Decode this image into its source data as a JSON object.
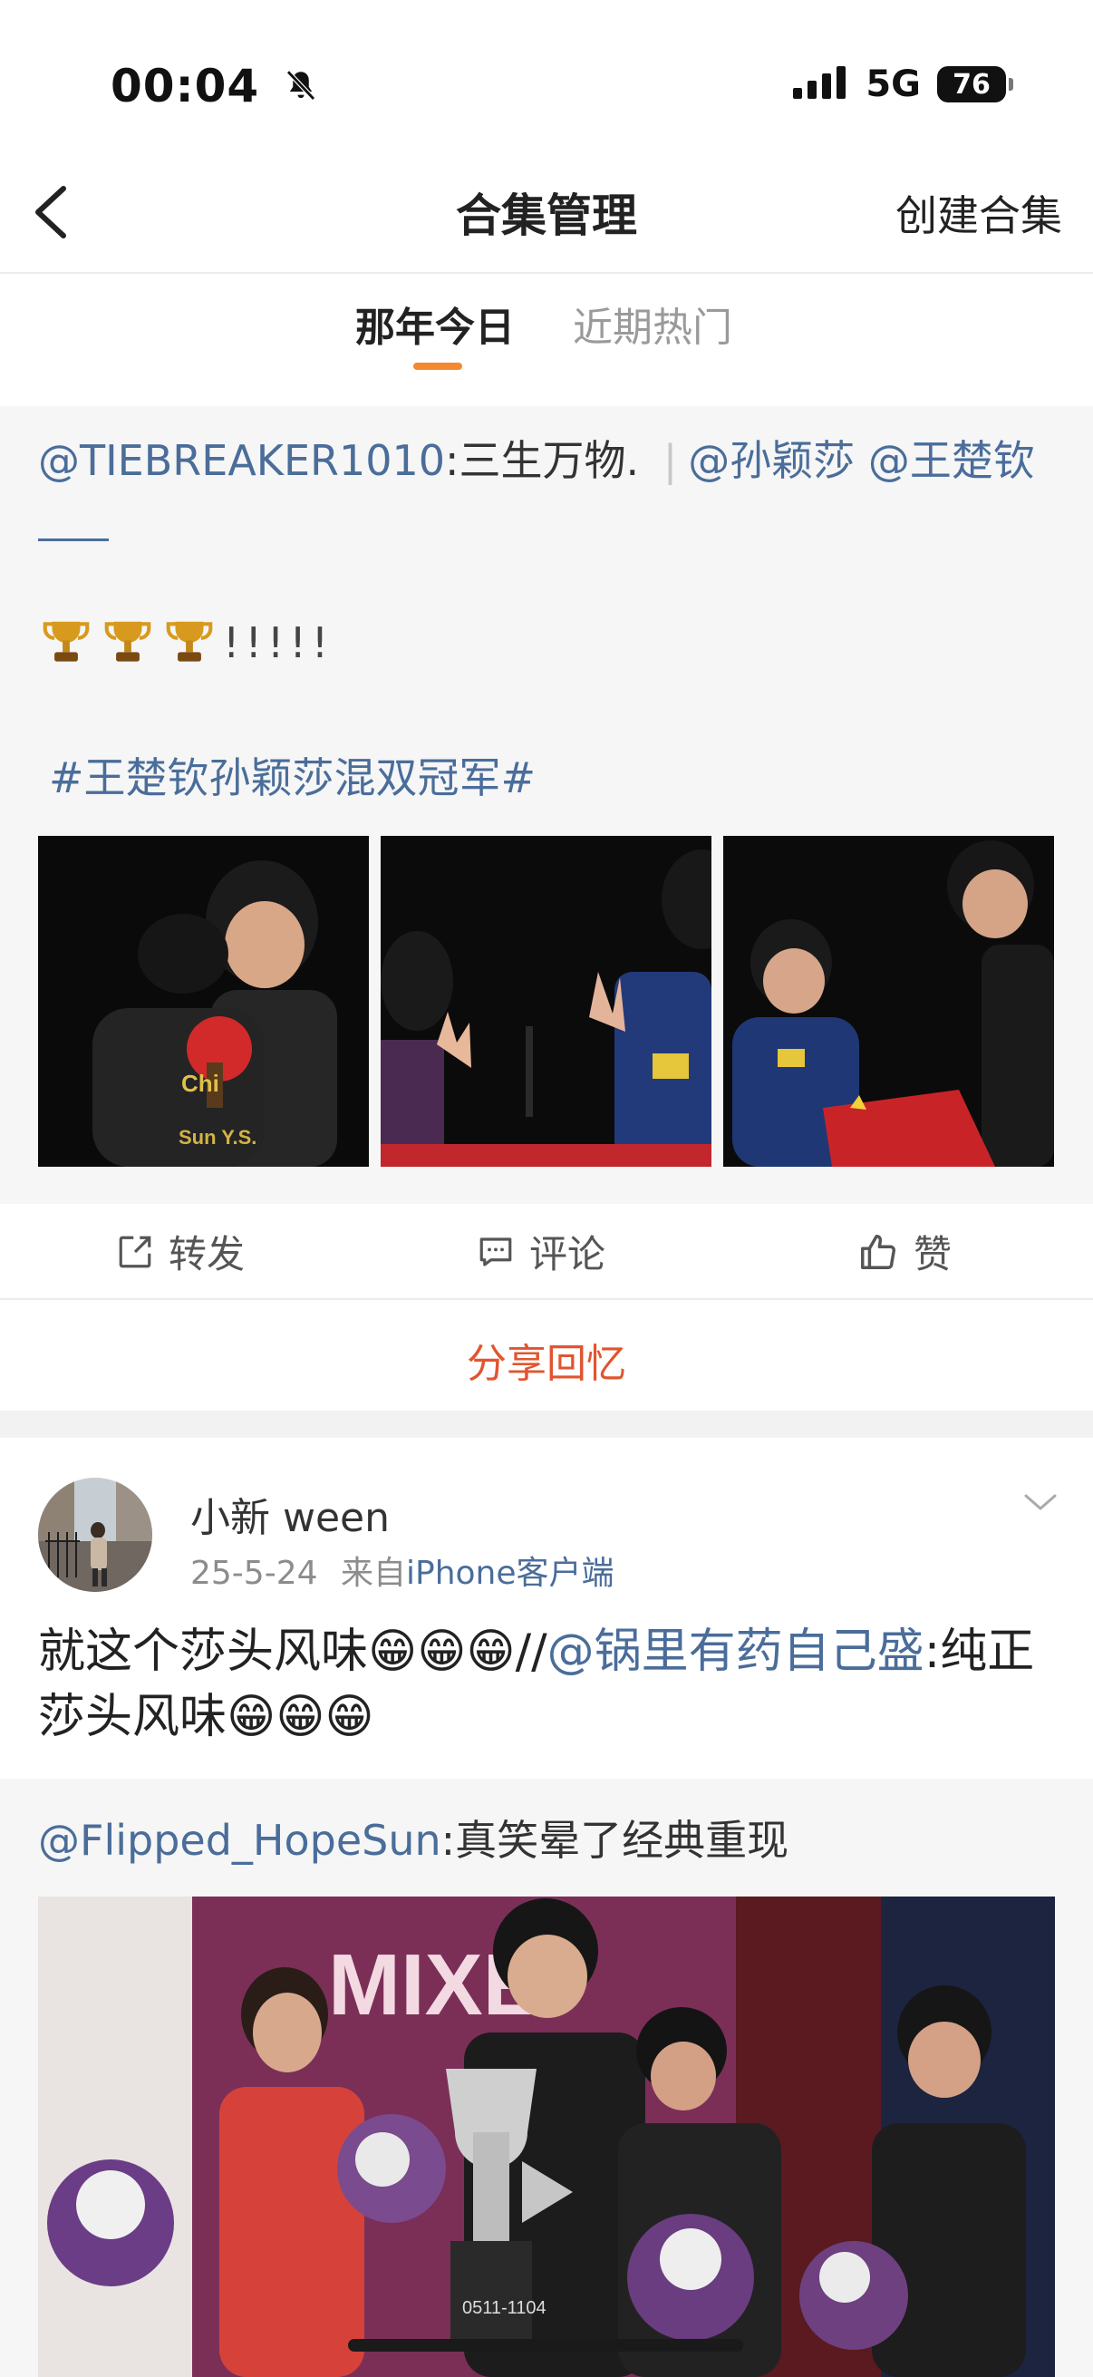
{
  "status_bar": {
    "time": "00:04",
    "network": "5G",
    "battery": "76"
  },
  "nav": {
    "title": "合集管理",
    "right_action": "创建合集"
  },
  "tabs": [
    {
      "label": "那年今日"
    },
    {
      "label": "近期热门"
    }
  ],
  "post1": {
    "repost_author": "@TIEBREAKER1010",
    "repost_text": ":三生万物. ",
    "sep": "|",
    "mention1": "@孙颖莎",
    "mention2": "@王楚钦",
    "exclaim": "!!!!!",
    "topic": "#王楚钦孙颖莎混双冠军#",
    "photo1_jersey": "Chi",
    "photo1_name": "Sun Y.S.",
    "actions": [
      {
        "label": "转发"
      },
      {
        "label": "评论"
      },
      {
        "label": "赞"
      }
    ],
    "share_label": "分享回忆"
  },
  "post2": {
    "author": "小新 ween",
    "date": "25-5-24",
    "source_prefix": "来自",
    "source": "iPhone客户端",
    "text_a": "就这个莎头风味😁😁😁//",
    "mention": "@锅里有药自己盛",
    "text_b": ":纯正莎头风味😁😁😁",
    "repost_author": "@Flipped_HopeSun",
    "repost_text": ":真笑晕了经典重现",
    "video_banner": "MIXE",
    "video_plate": "0511-1104"
  },
  "colors": {
    "link": "#4a6d9a",
    "accent": "#f5892f",
    "share": "#e0552f"
  }
}
